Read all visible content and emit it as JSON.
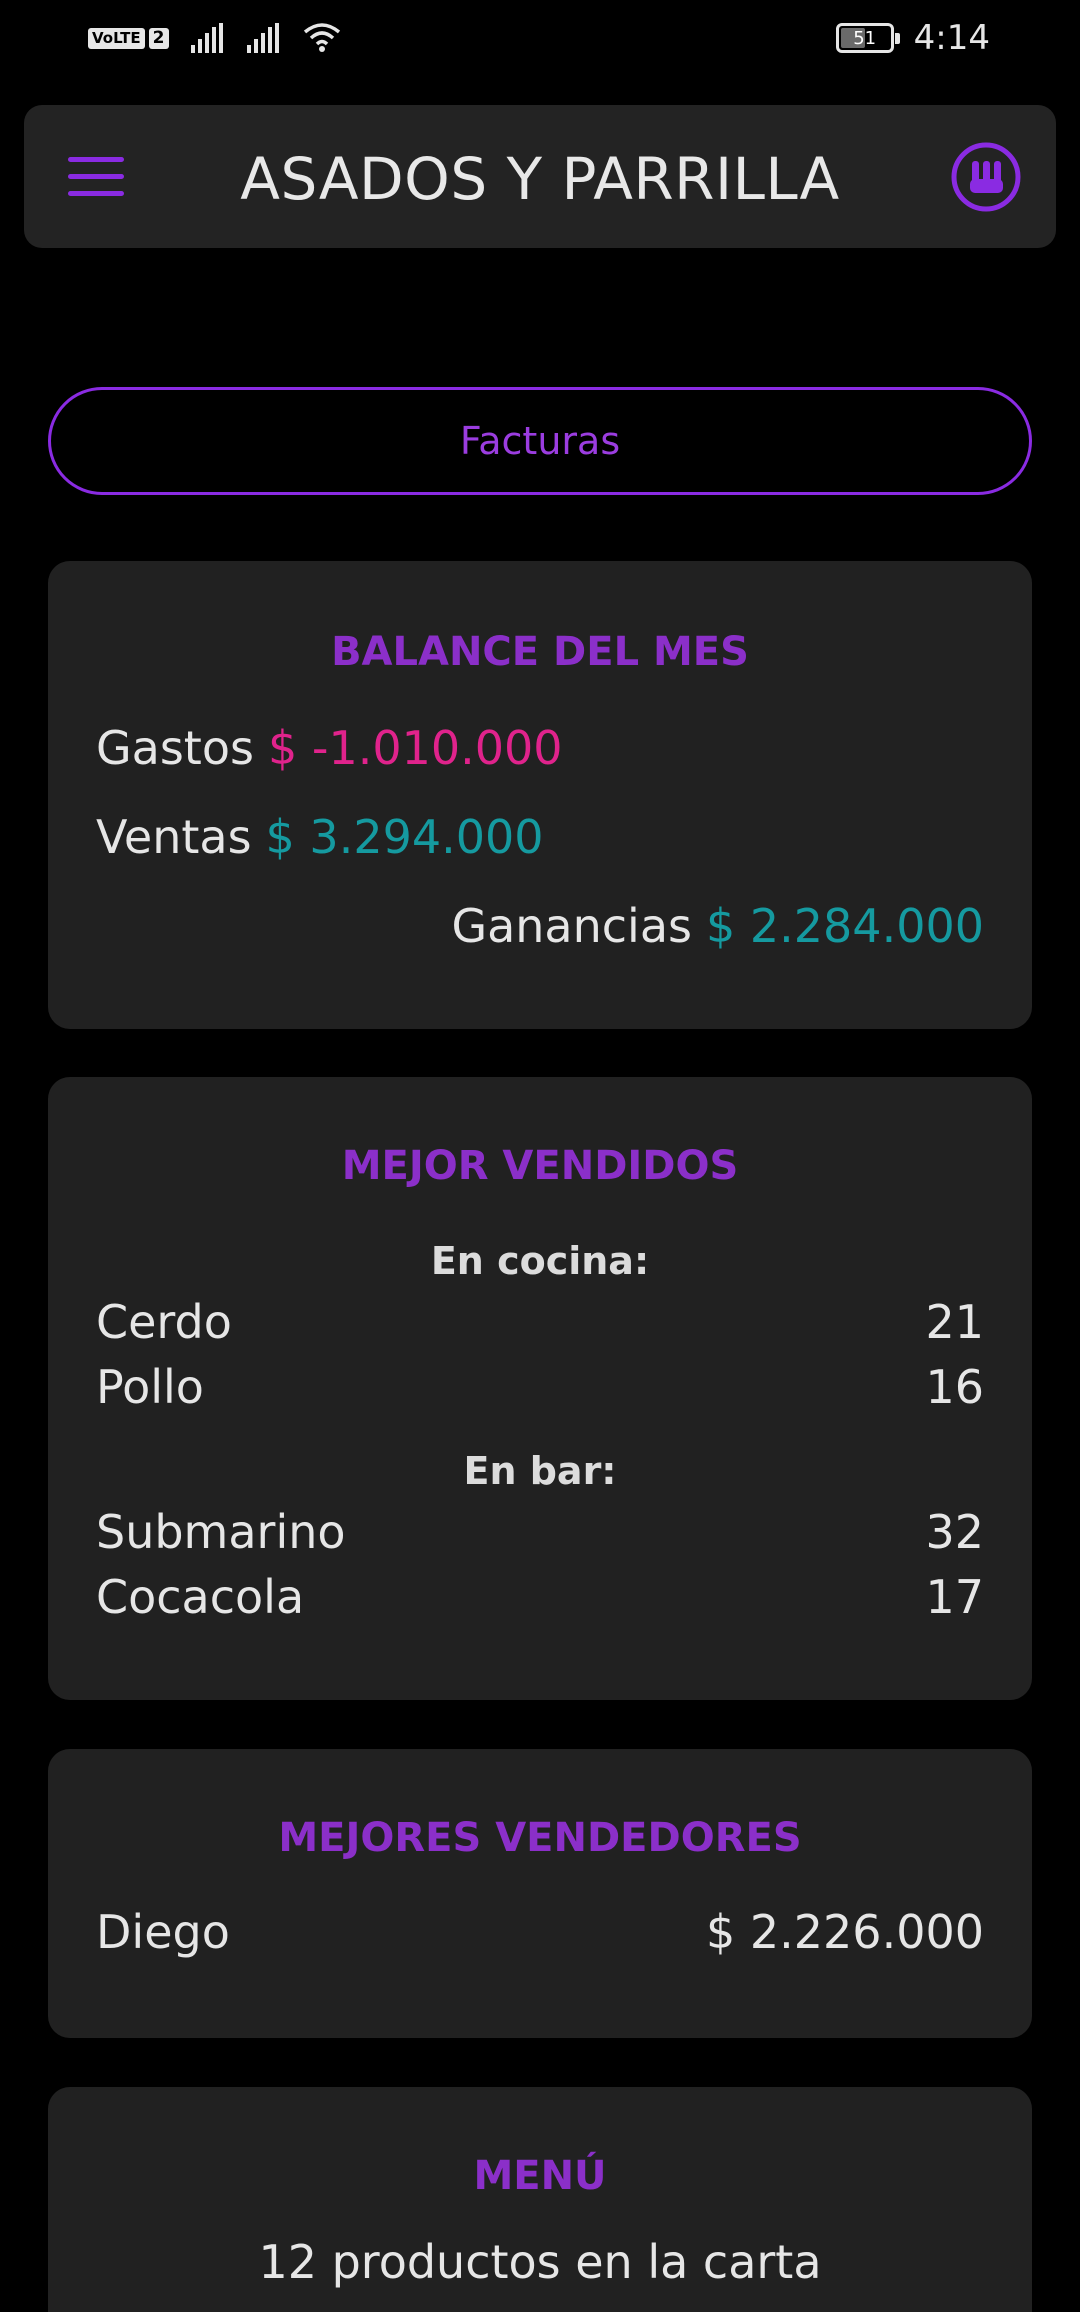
{
  "status_bar": {
    "volte": "VoLTE",
    "sim": "2",
    "battery": "51",
    "battery_level": 0.51,
    "time": "4:14"
  },
  "app_bar": {
    "title": "ASADOS Y PARRILLA",
    "menu_icon": "hamburger-icon",
    "logo_icon": "utensils-logo-icon"
  },
  "facturas_button": {
    "label": "Facturas"
  },
  "balance": {
    "title": "BALANCE DEL MES",
    "gastos_label": "Gastos",
    "gastos_value": "$ -1.010.000",
    "ventas_label": "Ventas",
    "ventas_value": "$ 3.294.000",
    "ganancias_label": "Ganancias",
    "ganancias_value": "$ 2.284.000"
  },
  "mejor_vendidos": {
    "title": "MEJOR VENDIDOS",
    "cocina_heading": "En cocina:",
    "cocina": [
      {
        "name": "Cerdo",
        "count": "21"
      },
      {
        "name": "Pollo",
        "count": "16"
      }
    ],
    "bar_heading": "En bar:",
    "bar": [
      {
        "name": "Submarino",
        "count": "32"
      },
      {
        "name": "Cocacola",
        "count": "17"
      }
    ]
  },
  "mejores_vendedores": {
    "title": "MEJORES VENDEDORES",
    "sellers": [
      {
        "name": "Diego",
        "amount": "$ 2.226.000"
      }
    ]
  },
  "menu": {
    "title": "MENÚ",
    "summary": "12 productos en la carta"
  },
  "colors": {
    "accent": "#8a2be2",
    "negative": "#e0238c",
    "positive": "#159aa0",
    "card_bg": "#212121"
  }
}
